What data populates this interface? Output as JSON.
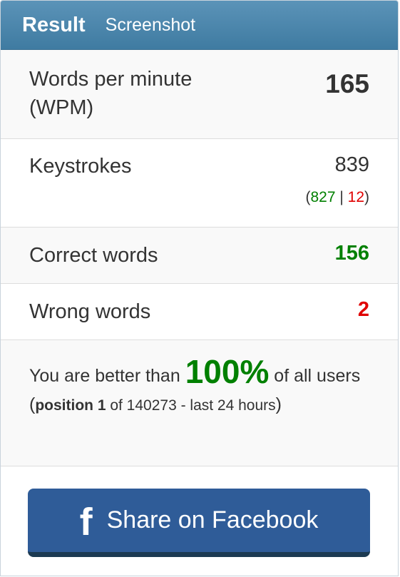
{
  "header": {
    "tab_result": "Result",
    "tab_screenshot": "Screenshot"
  },
  "wpm": {
    "label_line1": "Words per minute",
    "label_line2": "(WPM)",
    "value": "165"
  },
  "keystrokes": {
    "label": "Keystrokes",
    "value": "839",
    "open_paren": "(",
    "correct": "827",
    "separator": " | ",
    "wrong": "12",
    "close_paren": ")"
  },
  "correct_words": {
    "label": "Correct words",
    "value": "156"
  },
  "wrong_words": {
    "label": "Wrong words",
    "value": "2"
  },
  "rank": {
    "prefix": "You are better than ",
    "percent": "100%",
    "suffix": " of all users (",
    "position_label": "position 1",
    "position_rest": " of 140273 - last 24 hours",
    "close": ")"
  },
  "share": {
    "icon": "f",
    "label": "Share on Facebook"
  },
  "colors": {
    "header": "#4a87ad",
    "correct": "#008000",
    "wrong": "#e00000",
    "facebook": "#2f5c98"
  }
}
